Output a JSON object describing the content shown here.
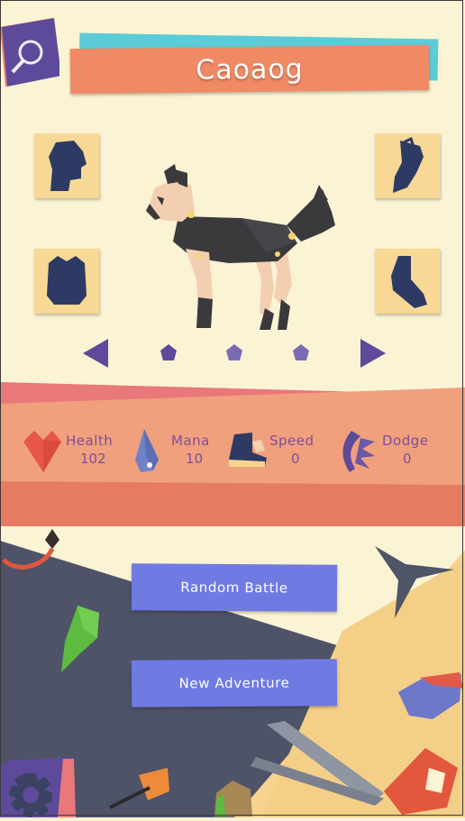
{
  "header": {
    "pet_name": "Caoaog"
  },
  "search": {
    "icon": "search-icon"
  },
  "equipment_slots": {
    "head": "head-slot-icon",
    "body": "body-slot-icon",
    "claws": "claw-slot-icon",
    "feet": "foot-slot-icon"
  },
  "navigation": {
    "prev_icon": "triangle-left-icon",
    "next_icon": "triangle-right-icon",
    "dots": 3
  },
  "stats": [
    {
      "label": "Health",
      "value": "102",
      "icon": "heart-icon"
    },
    {
      "label": "Mana",
      "value": "10",
      "icon": "drop-icon"
    },
    {
      "label": "Speed",
      "value": "0",
      "icon": "boot-icon"
    },
    {
      "label": "Dodge",
      "value": "0",
      "icon": "dodge-icon"
    }
  ],
  "buttons": {
    "random_battle": "Random Battle",
    "new_adventure": "New Adventure"
  },
  "settings": {
    "icon": "gear-icon"
  },
  "colors": {
    "background": "#faf3d4",
    "title": "#ef8a65",
    "accent_teal": "#5ccbd8",
    "slot": "#f7d894",
    "purple": "#5e4a9b",
    "button": "#6f7ae3",
    "stat_text": "#7f4f9c",
    "dark_paper": "#4f5368",
    "light_paper": "#f6d48f"
  }
}
